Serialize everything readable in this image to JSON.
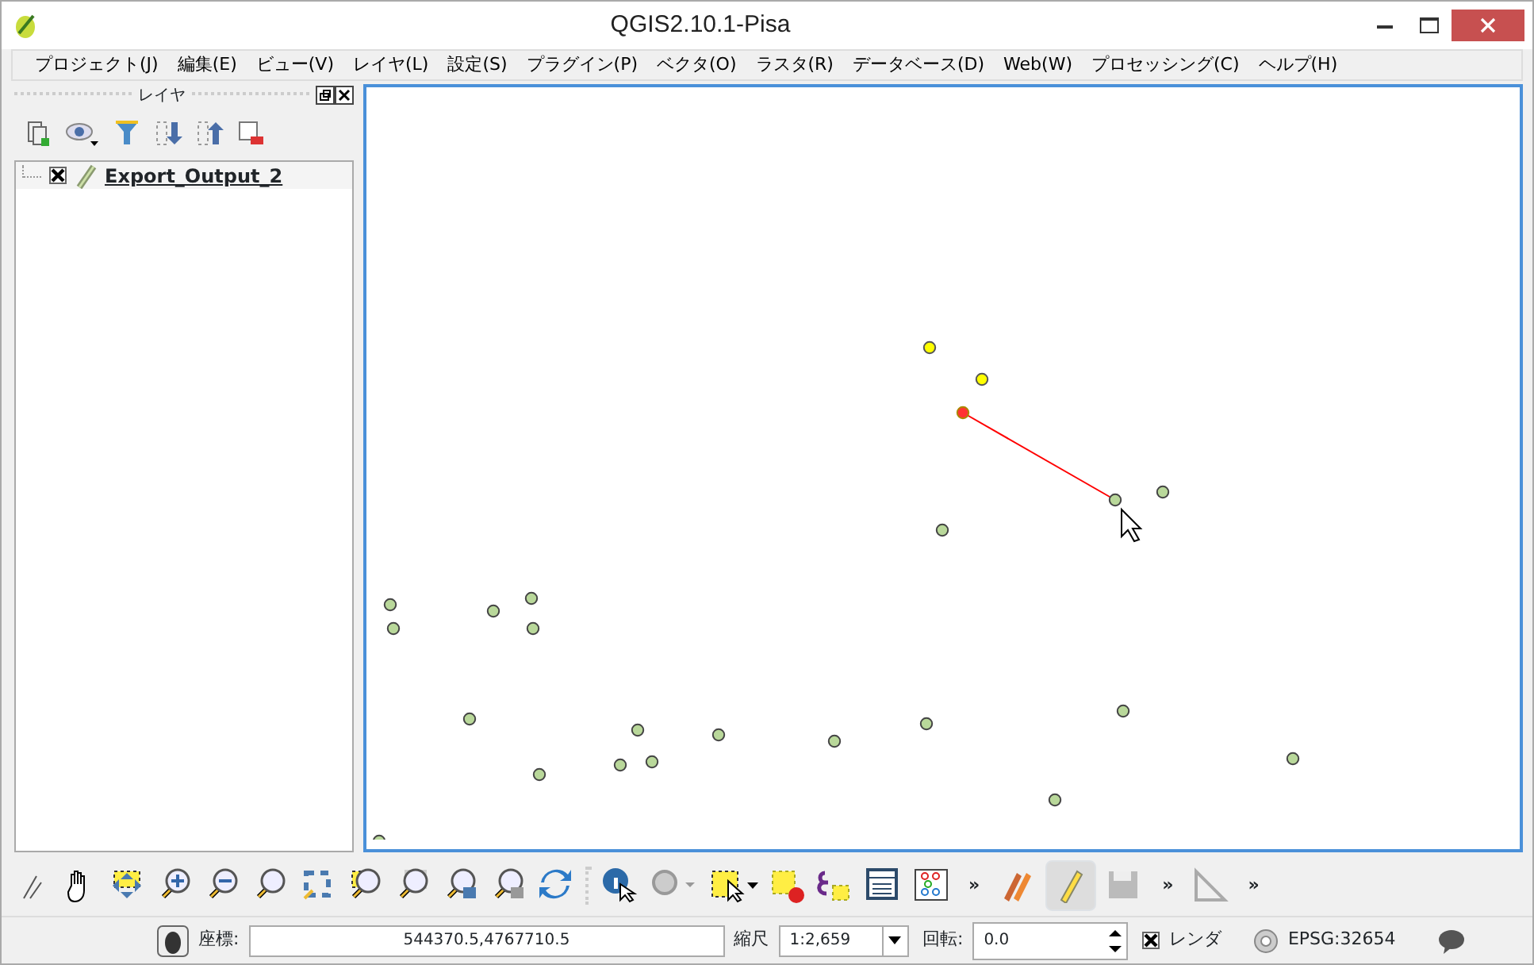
{
  "window": {
    "title": "QGIS2.10.1-Pisa"
  },
  "menu": [
    "プロジェクト(J)",
    "編集(E)",
    "ビュー(V)",
    "レイヤ(L)",
    "設定(S)",
    "プラグイン(P)",
    "ベクタ(O)",
    "ラスタ(R)",
    "データベース(D)",
    "Web(W)",
    "プロセッシング(C)",
    "ヘルプ(H)"
  ],
  "layers_panel": {
    "title": "レイヤ",
    "layers": [
      {
        "name": "Export_Output_2",
        "visible": true
      }
    ]
  },
  "toolbar": {
    "overflow_marks": [
      "»",
      "»",
      "»"
    ]
  },
  "status_bar": {
    "coordinate_label": "座標:",
    "coordinate_value": "544370.5,4767710.5",
    "scale_label": "縮尺",
    "scale_value": "1:2,659",
    "rotation_label": "回転:",
    "rotation_value": "0.0",
    "render_label": "レンダ",
    "render_checked": true,
    "crs": "EPSG:32654"
  }
}
